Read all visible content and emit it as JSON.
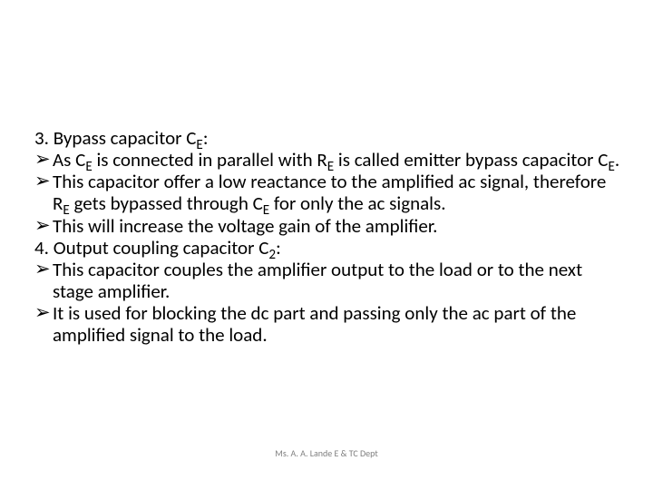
{
  "heading3": {
    "label_prefix": "3. Bypass capacitor C",
    "label_sub": "E",
    "label_suffix": ":"
  },
  "bullets3": [
    {
      "parts": [
        {
          "t": "As C"
        },
        {
          "t": "E",
          "sub": true
        },
        {
          "t": " is connected in parallel with R"
        },
        {
          "t": "E",
          "sub": true
        },
        {
          "t": " is called emitter bypass capacitor C"
        },
        {
          "t": "E",
          "sub": true
        },
        {
          "t": "."
        }
      ]
    },
    {
      "parts": [
        {
          "t": "This capacitor offer a low reactance to the amplified ac signal, therefore R"
        },
        {
          "t": "E",
          "sub": true
        },
        {
          "t": " gets bypassed through C"
        },
        {
          "t": "E",
          "sub": true
        },
        {
          "t": " for only the ac signals."
        }
      ]
    },
    {
      "parts": [
        {
          "t": "This will increase the voltage gain of the amplifier."
        }
      ]
    }
  ],
  "heading4": {
    "label_prefix": "4. Output coupling capacitor C",
    "label_sub": "2",
    "label_suffix": ":"
  },
  "bullets4": [
    {
      "parts": [
        {
          "t": "This capacitor couples the amplifier output to the load or to the next stage amplifier."
        }
      ]
    },
    {
      "parts": [
        {
          "t": "It is used for blocking the dc part and passing only the ac part of the amplified signal to the load."
        }
      ]
    }
  ],
  "bullet_glyph": "➢",
  "footer": "Ms. A. A. Lande E & TC Dept"
}
